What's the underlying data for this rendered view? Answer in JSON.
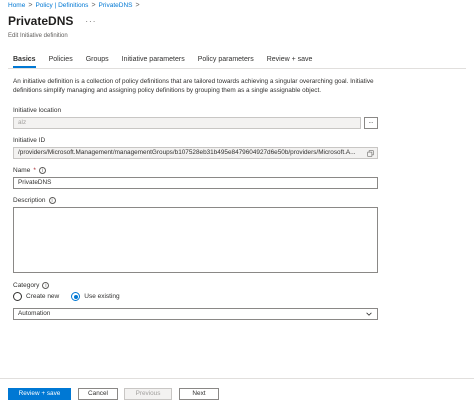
{
  "breadcrumb": {
    "items": [
      "Home",
      "Policy | Definitions",
      "PrivateDNS"
    ],
    "separator": ">"
  },
  "header": {
    "title": "PrivateDNS",
    "more_label": "···",
    "subtitle": "Edit Initiative definition"
  },
  "tabs": [
    "Basics",
    "Policies",
    "Groups",
    "Initiative parameters",
    "Policy parameters",
    "Review + save"
  ],
  "active_tab": "Basics",
  "description_text": "An initiative definition is a collection of policy definitions that are tailored towards achieving a singular overarching goal. Initiative definitions simplify managing and assigning policy definitions by grouping them as a single assignable object.",
  "form": {
    "initiative_location": {
      "label": "Initiative location",
      "value": "alz",
      "browse_label": "..."
    },
    "initiative_id": {
      "label": "Initiative ID",
      "value": "/providers/Microsoft.Management/managementGroups/b107528eb31b495e8479604927d6e50b/providers/Microsoft.A..."
    },
    "name": {
      "label": "Name",
      "required_mark": "*",
      "value": "PrivateDNS"
    },
    "description": {
      "label": "Description",
      "value": ""
    },
    "category": {
      "label": "Category",
      "options": [
        "Create new",
        "Use existing"
      ],
      "selected": "Use existing",
      "value": "Automation"
    }
  },
  "info_glyph": "i",
  "footer": {
    "review_save": "Review + save",
    "cancel": "Cancel",
    "previous": "Previous",
    "next": "Next"
  },
  "colors": {
    "accent": "#0078d4",
    "text": "#323130",
    "border": "#8a8886",
    "disabled_bg": "#f3f2f1"
  }
}
